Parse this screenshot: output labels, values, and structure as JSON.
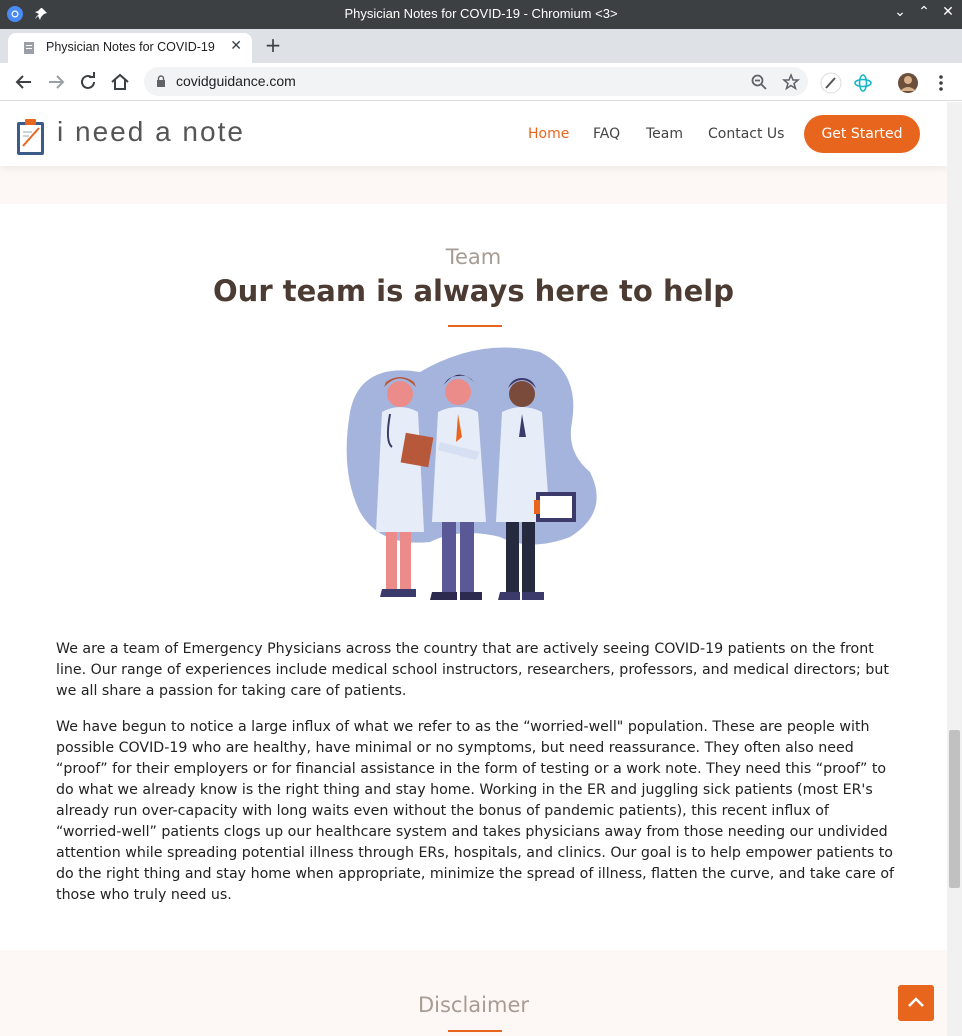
{
  "browser": {
    "window_title": "Physician Notes for COVID-19 - Chromium <3>",
    "tab_title": "Physician Notes for COVID-19",
    "url": "covidguidance.com"
  },
  "site": {
    "logo_text": "i need a note",
    "nav": {
      "home": "Home",
      "faq": "FAQ",
      "team": "Team",
      "contact": "Contact Us"
    },
    "cta_label": "Get Started"
  },
  "team": {
    "label": "Team",
    "title": "Our team is always here to help",
    "paragraph_1": "We are a team of Emergency Physicians across the country that are actively seeing COVID-19 patients on the front line. Our range of experiences include medical school instructors, researchers, professors, and medical directors; but we all share a passion for taking care of patients.",
    "paragraph_2": "We have begun to notice a large influx of what we refer to as the “worried-well\" population. These are people with possible COVID-19 who are healthy, have minimal or no symptoms, but need reassurance. They often also need “proof” for their employers or for financial assistance in the form of testing or a work note. They need this “proof” to do what we already know is the right thing and stay home. Working in the ER and juggling sick patients (most ER's already run over-capacity with long waits even without the bonus of pandemic patients), this recent influx of “worried-well” patients clogs up our healthcare system and takes physicians away from those needing our undivided attention while spreading potential illness through ERs, hospitals, and clinics. Our goal is to help empower patients to do the right thing and stay home when appropriate, minimize the spread of illness, flatten the curve, and take care of those who truly need us."
  },
  "disclaimer": {
    "label": "Disclaimer"
  },
  "colors": {
    "accent": "#e8651e",
    "title": "#4b3b32",
    "label": "#a79b94",
    "blob": "#a5b4dc"
  }
}
